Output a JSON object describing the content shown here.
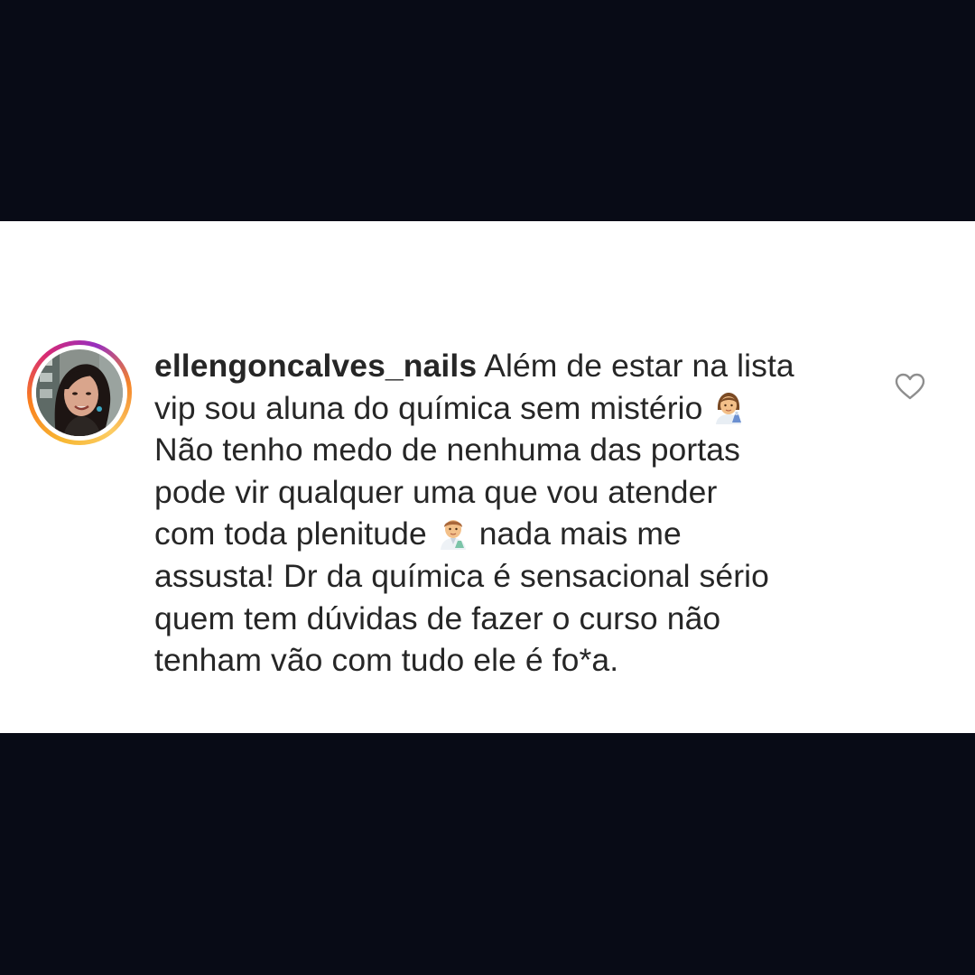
{
  "comment": {
    "username": "ellengoncalves_nails",
    "lines": [
      " Além de estar na lista",
      "vip sou aluna do química sem mistério ",
      "Não tenho medo de nenhuma  das portas",
      "pode vir qualquer uma  que vou atender",
      "com toda plenitude ",
      " nada mais me",
      "assusta!  Dr da química é sensacional sério",
      "quem tem dúvidas de fazer o curso não",
      "tenham vão com tudo ele é fo*a."
    ],
    "emojis": [
      "woman-scientist-emoji",
      "man-scientist-emoji"
    ]
  },
  "icons": {
    "like": "heart-outline-icon"
  },
  "colors": {
    "background": "#080b16",
    "card": "#ffffff",
    "text": "#262626",
    "heart_stroke": "#8e8e8e"
  }
}
